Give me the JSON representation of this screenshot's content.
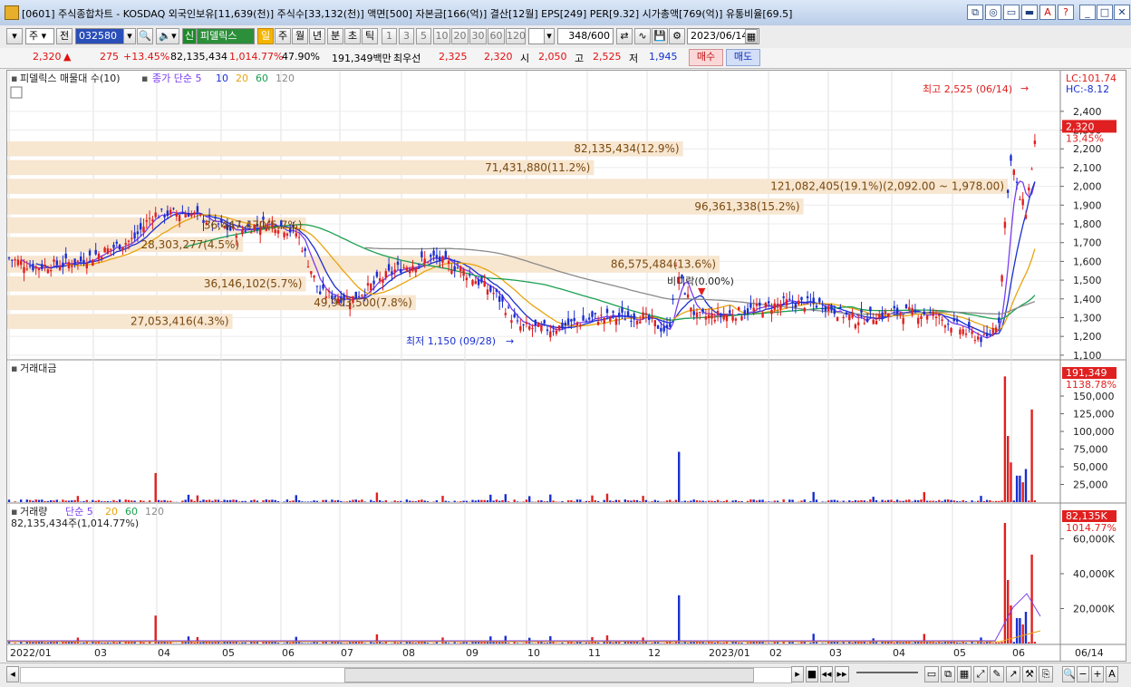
{
  "window": {
    "title": "[0601] 주식종합차트 - KOSDAQ 외국인보유[11,639(천)] 주식수[33,132(천)] 액면[500] 자본금[166(억)] 결산[12월] EPS[249] PER[9.32] 시가총액[769(억)] 유통비율[69.5]",
    "buttons": [
      "⧉",
      "◎",
      "▭",
      "▬",
      "A",
      "?",
      "_",
      "□",
      "✕"
    ]
  },
  "toolbar": {
    "period_select": "주",
    "prev_label": "전",
    "code": "032580",
    "name_badge": "신",
    "stock_name": "피델릭스",
    "periods": [
      "일",
      "주",
      "월",
      "년",
      "분",
      "초",
      "틱"
    ],
    "active_period": "일",
    "intervals": [
      "1",
      "3",
      "5",
      "10",
      "20",
      "30",
      "60",
      "120"
    ],
    "count": "348",
    "count_max": "/600",
    "date": "2023/06/14"
  },
  "quote": {
    "price": "2,320",
    "arrow": "▲",
    "change": "275",
    "change_pct": "+13.45%",
    "volume": "82,135,434",
    "volume_ratio": "1,014.77%",
    "pct": "47.90%",
    "amount": "191,349백만",
    "best_ask_label": "최우선",
    "best_ask": "2,325",
    "best_bid": "2,320",
    "open_label": "시",
    "open": "2,050",
    "high_label": "고",
    "high": "2,525",
    "low_label": "저",
    "low": "1,945",
    "buy_label": "매수",
    "sell_label": "매도"
  },
  "chart_data": [
    {
      "type": "candlestick",
      "title": "피델릭스 매물대 수(10)",
      "legend": [
        "종가 단순 5",
        "10",
        "20",
        "60",
        "120"
      ],
      "y_axis_ticks": [
        2400,
        2300,
        2200,
        2100,
        2000,
        1900,
        1800,
        1700,
        1600,
        1500,
        1400,
        1300,
        1200,
        1100
      ],
      "right_labels": {
        "lc": "LC:101.74",
        "hc": "HC:-8.12",
        "price": "2,320",
        "price_pct": "13.45%"
      },
      "volume_profile": [
        {
          "label": "82,135,434(12.9%)",
          "price_low": 2160,
          "price_high": 2240
        },
        {
          "label": "71,431,880(11.2%)",
          "price_low": 2060,
          "price_high": 2140
        },
        {
          "label": "121,082,405(19.1%)(2,092.00 ~ 1,978.00)",
          "price_low": 1960,
          "price_high": 2040
        },
        {
          "label": "96,361,338(15.2%)",
          "price_low": 1850,
          "price_high": 1935
        },
        {
          "label": "36,447,470(5.7%)",
          "price_low": 1750,
          "price_high": 1835
        },
        {
          "label": "28,303,277(4.5%)",
          "price_low": 1650,
          "price_high": 1730
        },
        {
          "label": "86,575,484(13.6%)",
          "price_low": 1540,
          "price_high": 1630
        },
        {
          "label": "36,146,102(5.7%)",
          "price_low": 1440,
          "price_high": 1520
        },
        {
          "label": "49,903,500(7.8%)",
          "price_low": 1340,
          "price_high": 1420
        },
        {
          "label": "27,053,416(4.3%)",
          "price_low": 1240,
          "price_high": 1320
        }
      ],
      "annotations": {
        "high": "최고 2,525 (06/14)",
        "low": "최저 1,150 (09/28)",
        "limit": "비디락(0.00%)"
      }
    },
    {
      "type": "bar",
      "title": "거래대금",
      "y_axis_ticks": [
        150000,
        125000,
        100000,
        75000,
        50000,
        25000
      ],
      "y_tick_labels": [
        "150,000",
        "125,000",
        "100,000",
        "75,000",
        "50,000",
        "25,000"
      ],
      "last": "191,349",
      "last_pct": "1138.78%"
    },
    {
      "type": "bar",
      "title": "거래량",
      "legend": [
        "단순 5",
        "20",
        "60",
        "120"
      ],
      "subtitle": "82,135,434주(1,014.77%)",
      "y_axis_ticks": [
        60000,
        40000,
        20000
      ],
      "y_tick_labels": [
        "60,000K",
        "40,000K",
        "20,000K"
      ],
      "last": "82,135K",
      "last_pct": "1014.77%"
    }
  ],
  "x_axis_labels": [
    "2022/01",
    "03",
    "04",
    "05",
    "06",
    "07",
    "08",
    "09",
    "10",
    "11",
    "12",
    "2023/01",
    "02",
    "03",
    "04",
    "05",
    "06",
    "06/14"
  ],
  "colors": {
    "up": "#e02020",
    "down": "#1a2fd0",
    "ma5": "#7a3df0",
    "ma10": "#1a2fd0",
    "ma20": "#e8a40e",
    "ma60": "#1aa050",
    "ma120": "#8a8a8a",
    "profile": "#f7e6d0"
  }
}
